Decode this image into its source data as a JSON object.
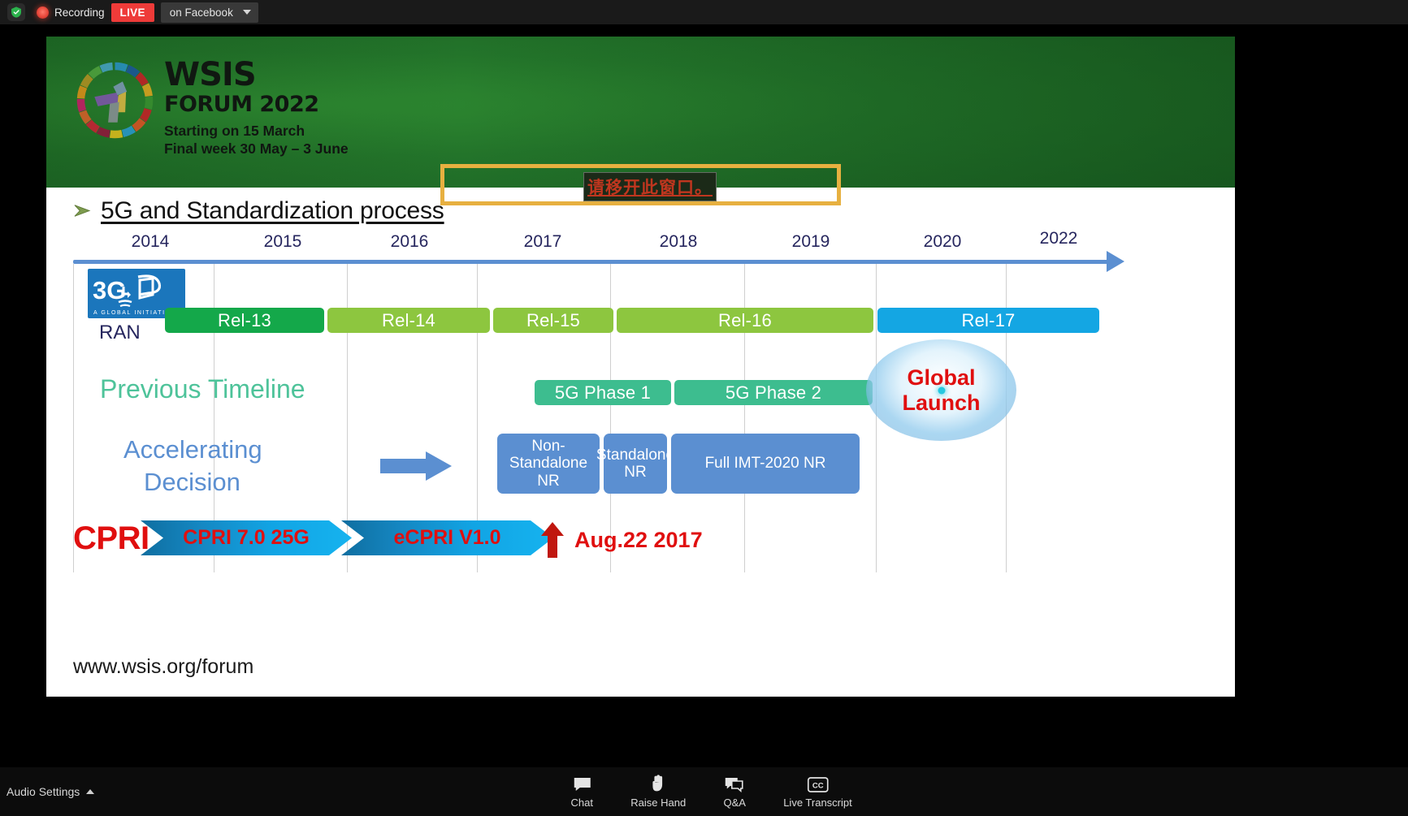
{
  "topbar": {
    "shield_icon": "shield-check-icon",
    "rec_icon": "recording-dot-icon",
    "recording_label": "Recording",
    "live_label": "LIVE",
    "platform_label": "on Facebook",
    "caret_icon": "chevron-down-icon"
  },
  "slide": {
    "banner": {
      "logo_icon": "wsis-sdg-wheel-logo",
      "title": "WSIS",
      "subtitle": "FORUM 2022",
      "date_line1": "Starting on 15 March",
      "date_line2": "Final week 30 May – 3 June"
    },
    "annotation": {
      "highlight_color": "#e7b040",
      "overlay_text": "请移开此窗口。",
      "overlay_color": "#c0361f"
    },
    "bullet_icon": "arrow-bullet-icon",
    "title": "5G and Standardization process",
    "footer_url": "www.wsis.org/forum"
  },
  "chart_data": {
    "type": "timeline",
    "title": "5G and Standardization process",
    "axis_years": [
      "2014",
      "2015",
      "2016",
      "2017",
      "2018",
      "2019",
      "2020",
      "2022"
    ],
    "axis_color": "#5b8fd1",
    "rows": [
      {
        "name": "RAN",
        "label": "RAN",
        "logo": "3GPP",
        "logo_sub": "A GLOBAL INITIATIVE",
        "items": [
          {
            "label": "Rel-13",
            "start": "2014",
            "end": "2015",
            "color": "#14a84a"
          },
          {
            "label": "Rel-14",
            "start": "2015",
            "end": "2016",
            "color": "#8dc63f"
          },
          {
            "label": "Rel-15",
            "start": "2016",
            "end": "2017",
            "color": "#8dc63f"
          },
          {
            "label": "Rel-16",
            "start": "2017",
            "end": "2019",
            "color": "#8dc63f"
          },
          {
            "label": "Rel-17",
            "start": "2019",
            "end": "2022",
            "color": "#14a6e3"
          }
        ]
      },
      {
        "name": "Previous Timeline",
        "label": "Previous Timeline",
        "label_color": "#4ec39a",
        "items": [
          {
            "label": "5G Phase 1",
            "start": "2017",
            "end": "2018",
            "color": "#3dbd8f"
          },
          {
            "label": "5G Phase 2",
            "start": "2018",
            "end": "2019",
            "color": "#3dbd8f"
          }
        ],
        "milestone": {
          "label_line1": "Global",
          "label_line2": "Launch",
          "color": "#e00f0f",
          "year": "2020"
        }
      },
      {
        "name": "Accelerating Decision",
        "label_line1": "Accelerating",
        "label_line2": "Decision",
        "label_color": "#5b8fd1",
        "arrow_icon": "right-arrow-icon",
        "items": [
          {
            "label": "Non-Standalone NR",
            "start": "2017",
            "color": "#5b8fd1"
          },
          {
            "label": "Standalone NR",
            "start": "2017",
            "color": "#5b8fd1"
          },
          {
            "label": "Full IMT-2020 NR",
            "start": "2018",
            "end": "2019",
            "color": "#5b8fd1"
          }
        ]
      },
      {
        "name": "CPRI",
        "label": "CPRI",
        "label_color": "#e00f0f",
        "items": [
          {
            "label": "CPRI 7.0 25G",
            "start": "2014",
            "end": "2016",
            "shape": "chevron"
          },
          {
            "label": "eCPRI V1.0",
            "start": "2016",
            "end": "2017",
            "shape": "chevron"
          }
        ],
        "annotation": {
          "icon": "up-arrow-icon",
          "label": "Aug.22 2017",
          "color": "#e00f0f"
        }
      }
    ]
  },
  "bottombar": {
    "audio_settings_label": "Audio Settings",
    "audio_caret_icon": "chevron-up-icon",
    "tools": [
      {
        "icon": "chat-bubble-icon",
        "label": "Chat"
      },
      {
        "icon": "raise-hand-icon",
        "label": "Raise Hand"
      },
      {
        "icon": "qa-bubble-icon",
        "label": "Q&A"
      },
      {
        "icon": "closed-caption-icon",
        "label": "Live Transcript"
      }
    ]
  }
}
